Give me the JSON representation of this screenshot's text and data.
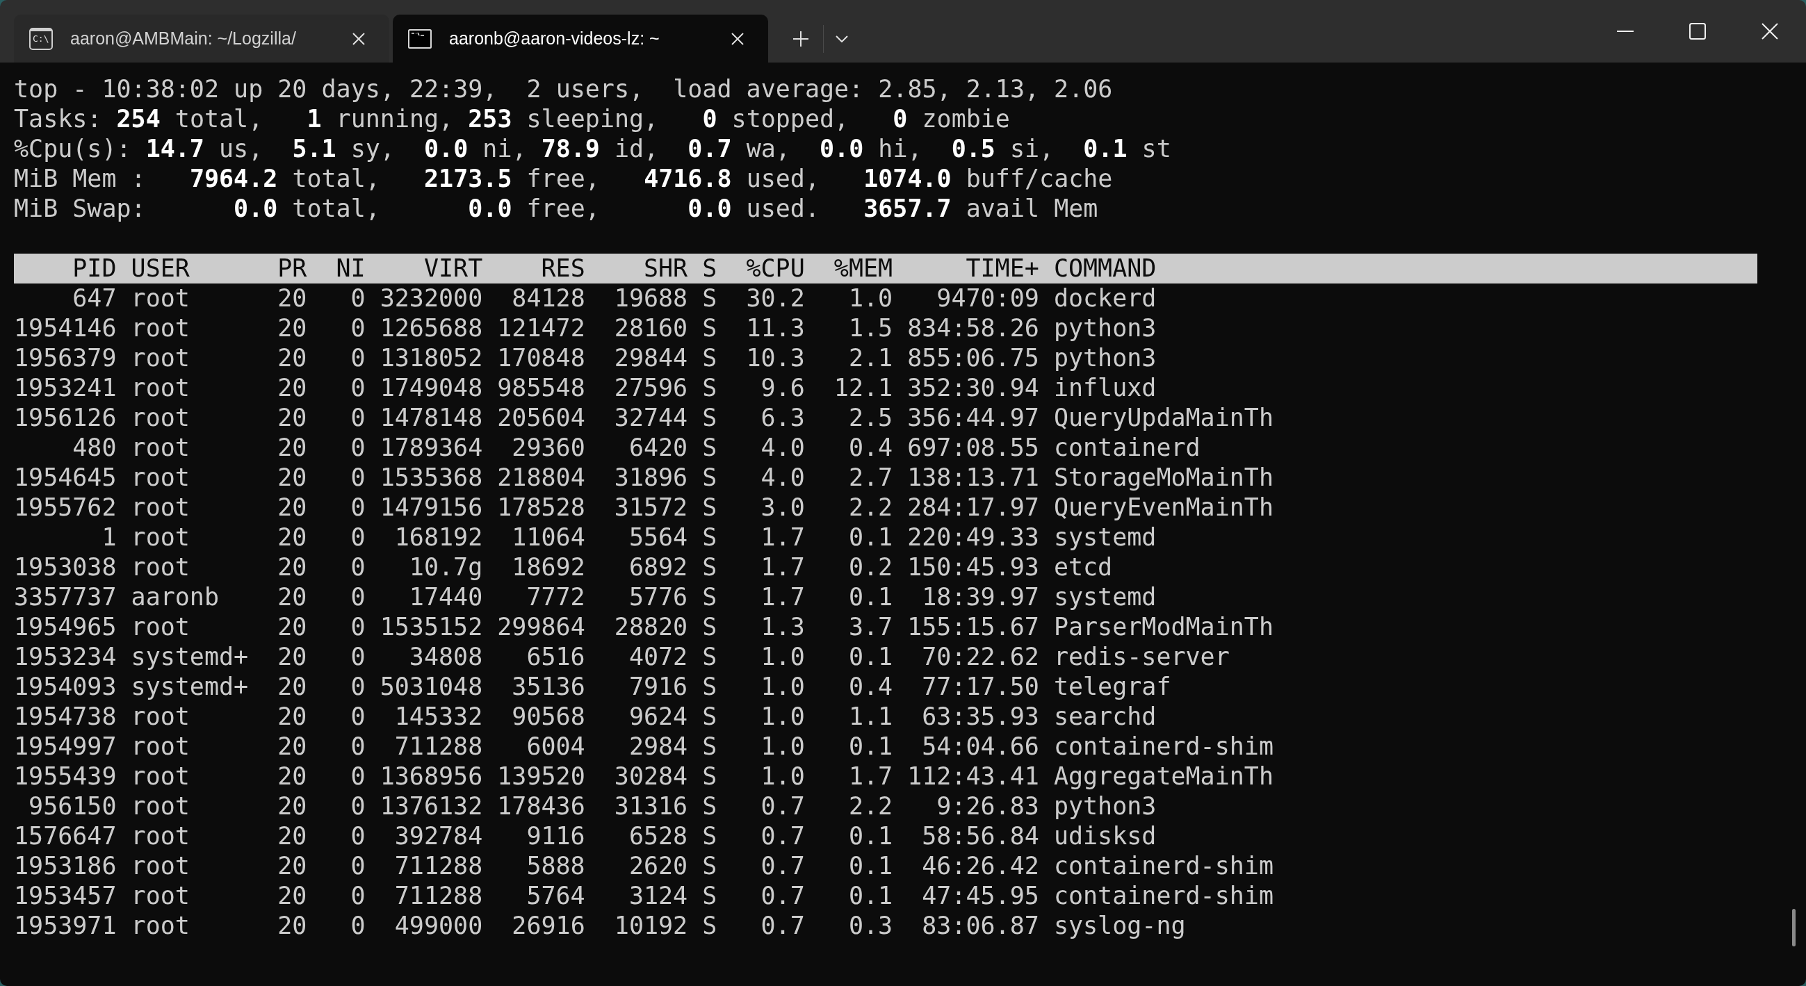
{
  "window": {
    "tabs": [
      {
        "kind": "cmd",
        "icon_label": "C:\\",
        "title": "aaron@AMBMain: ~/Logzilla/",
        "selected": false
      },
      {
        "kind": "console",
        "title": "aaronb@aaron-videos-lz: ~",
        "selected": true
      }
    ]
  },
  "terminal": {
    "summary_lines": [
      "top - 10:38:02 up 20 days, 22:39,  2 users,  load average: 2.85, 2.13, 2.06",
      "Tasks: **254** total,   **1** running, **253** sleeping,   **0** stopped,   **0** zombie",
      "%Cpu(s): **14.7** us,  **5.1** sy,  **0.0** ni, **78.9** id,  **0.7** wa,  **0.0** hi,  **0.5** si,  **0.1** st",
      "MiB Mem :   **7964.2** total,   **2173.5** free,   **4716.8** used,   **1074.0** buff/cache",
      "MiB Swap:      **0.0** total,      **0.0** free,      **0.0** used.   **3657.7** avail Mem"
    ],
    "process_table": {
      "columns": [
        "PID",
        "USER",
        "PR",
        "NI",
        "VIRT",
        "RES",
        "SHR",
        "S",
        "%CPU",
        "%MEM",
        "TIME+",
        "COMMAND"
      ],
      "rows": [
        [
          "647",
          "root",
          "20",
          "0",
          "3232000",
          "84128",
          "19688",
          "S",
          "30.2",
          "1.0",
          "9470:09",
          "dockerd"
        ],
        [
          "1954146",
          "root",
          "20",
          "0",
          "1265688",
          "121472",
          "28160",
          "S",
          "11.3",
          "1.5",
          "834:58.26",
          "python3"
        ],
        [
          "1956379",
          "root",
          "20",
          "0",
          "1318052",
          "170848",
          "29844",
          "S",
          "10.3",
          "2.1",
          "855:06.75",
          "python3"
        ],
        [
          "1953241",
          "root",
          "20",
          "0",
          "1749048",
          "985548",
          "27596",
          "S",
          "9.6",
          "12.1",
          "352:30.94",
          "influxd"
        ],
        [
          "1956126",
          "root",
          "20",
          "0",
          "1478148",
          "205604",
          "32744",
          "S",
          "6.3",
          "2.5",
          "356:44.97",
          "QueryUpdaMainTh"
        ],
        [
          "480",
          "root",
          "20",
          "0",
          "1789364",
          "29360",
          "6420",
          "S",
          "4.0",
          "0.4",
          "697:08.55",
          "containerd"
        ],
        [
          "1954645",
          "root",
          "20",
          "0",
          "1535368",
          "218804",
          "31896",
          "S",
          "4.0",
          "2.7",
          "138:13.71",
          "StorageMoMainTh"
        ],
        [
          "1955762",
          "root",
          "20",
          "0",
          "1479156",
          "178528",
          "31572",
          "S",
          "3.0",
          "2.2",
          "284:17.97",
          "QueryEvenMainTh"
        ],
        [
          "1",
          "root",
          "20",
          "0",
          "168192",
          "11064",
          "5564",
          "S",
          "1.7",
          "0.1",
          "220:49.33",
          "systemd"
        ],
        [
          "1953038",
          "root",
          "20",
          "0",
          "10.7g",
          "18692",
          "6892",
          "S",
          "1.7",
          "0.2",
          "150:45.93",
          "etcd"
        ],
        [
          "3357737",
          "aaronb",
          "20",
          "0",
          "17440",
          "7772",
          "5776",
          "S",
          "1.7",
          "0.1",
          "18:39.97",
          "systemd"
        ],
        [
          "1954965",
          "root",
          "20",
          "0",
          "1535152",
          "299864",
          "28820",
          "S",
          "1.3",
          "3.7",
          "155:15.67",
          "ParserModMainTh"
        ],
        [
          "1953234",
          "systemd+",
          "20",
          "0",
          "34808",
          "6516",
          "4072",
          "S",
          "1.0",
          "0.1",
          "70:22.62",
          "redis-server"
        ],
        [
          "1954093",
          "systemd+",
          "20",
          "0",
          "5031048",
          "35136",
          "7916",
          "S",
          "1.0",
          "0.4",
          "77:17.50",
          "telegraf"
        ],
        [
          "1954738",
          "root",
          "20",
          "0",
          "145332",
          "90568",
          "9624",
          "S",
          "1.0",
          "1.1",
          "63:35.93",
          "searchd"
        ],
        [
          "1954997",
          "root",
          "20",
          "0",
          "711288",
          "6004",
          "2984",
          "S",
          "1.0",
          "0.1",
          "54:04.66",
          "containerd-shim"
        ],
        [
          "1955439",
          "root",
          "20",
          "0",
          "1368956",
          "139520",
          "30284",
          "S",
          "1.0",
          "1.7",
          "112:43.41",
          "AggregateMainTh"
        ],
        [
          "956150",
          "root",
          "20",
          "0",
          "1376132",
          "178436",
          "31316",
          "S",
          "0.7",
          "2.2",
          "9:26.83",
          "python3"
        ],
        [
          "1576647",
          "root",
          "20",
          "0",
          "392784",
          "9116",
          "6528",
          "S",
          "0.7",
          "0.1",
          "58:56.84",
          "udisksd"
        ],
        [
          "1953186",
          "root",
          "20",
          "0",
          "711288",
          "5888",
          "2620",
          "S",
          "0.7",
          "0.1",
          "46:26.42",
          "containerd-shim"
        ],
        [
          "1953457",
          "root",
          "20",
          "0",
          "711288",
          "5764",
          "3124",
          "S",
          "0.7",
          "0.1",
          "47:45.95",
          "containerd-shim"
        ],
        [
          "1953971",
          "root",
          "20",
          "0",
          "499000",
          "26916",
          "10192",
          "S",
          "0.7",
          "0.3",
          "83:06.87",
          "syslog-ng"
        ]
      ]
    }
  }
}
